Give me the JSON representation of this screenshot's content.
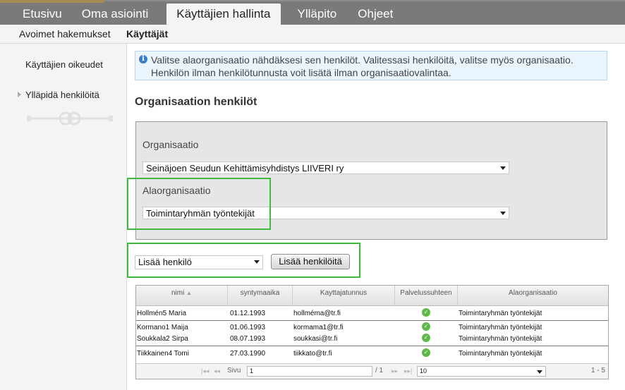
{
  "nav": {
    "tabs": [
      "Etusivu",
      "Oma asiointi",
      "Käyttäjien hallinta",
      "Ylläpito",
      "Ohjeet"
    ],
    "active_tab": "Käyttäjien hallinta"
  },
  "subnav": {
    "items": [
      "Avoimet hakemukset",
      "Käyttäjät"
    ],
    "active": "Käyttäjät"
  },
  "sidebar": {
    "items": [
      "Käyttäjien oikeudet",
      "Ylläpidä henkilöitä"
    ]
  },
  "info": {
    "icon": "info-icon",
    "line1": "Valitse alaorganisaatio nähdäksesi sen henkilöt. Valitessasi henkilöitä, valitse myös organisaatio.",
    "line2": "Henkilön ilman henkilötunnusta voit lisätä ilman organisaatiovalintaa."
  },
  "page": {
    "title": "Organisaation henkilöt"
  },
  "filters": {
    "org_label": "Organisaatio",
    "org_value": "Seinäjoen Seudun Kehittämisyhdistys LIIVERI ry",
    "suborg_label": "Alaorganisaatio",
    "suborg_value": "Toimintaryhmän työntekijät"
  },
  "actions": {
    "add_select_value": "Lisää henkilö",
    "add_button": "Lisää henkilöitä"
  },
  "table": {
    "columns": [
      "nimi",
      "syntymaaika",
      "Kayttajatunnus",
      "Palvelussuhteen",
      "Alaorganisaatio"
    ],
    "sort_indicator": "▲",
    "rows": [
      {
        "name": "Hollmén5 Maria",
        "birth": "01.12.1993",
        "user": "hollméma@tr.fi",
        "status_icon": "check-icon",
        "suborg": "Toimintaryhmän työntekijät"
      },
      {
        "name": "Kormano1 Maija",
        "birth": "01.06.1993",
        "user": "kormama1@tr.fi",
        "status_icon": "check-icon",
        "suborg": "Toimintaryhmän työntekijät"
      },
      {
        "name": "Soukkala2 Sirpa",
        "birth": "08.07.1993",
        "user": "soukkasi@tr.fi",
        "status_icon": "check-icon",
        "suborg": "Toimintaryhmän työntekijät"
      },
      {
        "name": "Tiikkainen4 Tomi",
        "birth": "27.03.1990",
        "user": "tiikkato@tr.fi",
        "status_icon": "check-icon",
        "suborg": "Toimintaryhmän työntekijät"
      }
    ],
    "pager": {
      "first": "|◂◂",
      "prev": "◂◂",
      "page_label": "Sivu",
      "page_value": "1",
      "of_label": "/ 1",
      "next": "▸▸",
      "last": "▸▸|",
      "rows_value": "10",
      "range": "1 - 5"
    }
  },
  "colors": {
    "topbar": "#7a7a7a",
    "highlight": "#3fba3f",
    "info_bg": "#eaf4fd",
    "check": "#5fb946"
  }
}
